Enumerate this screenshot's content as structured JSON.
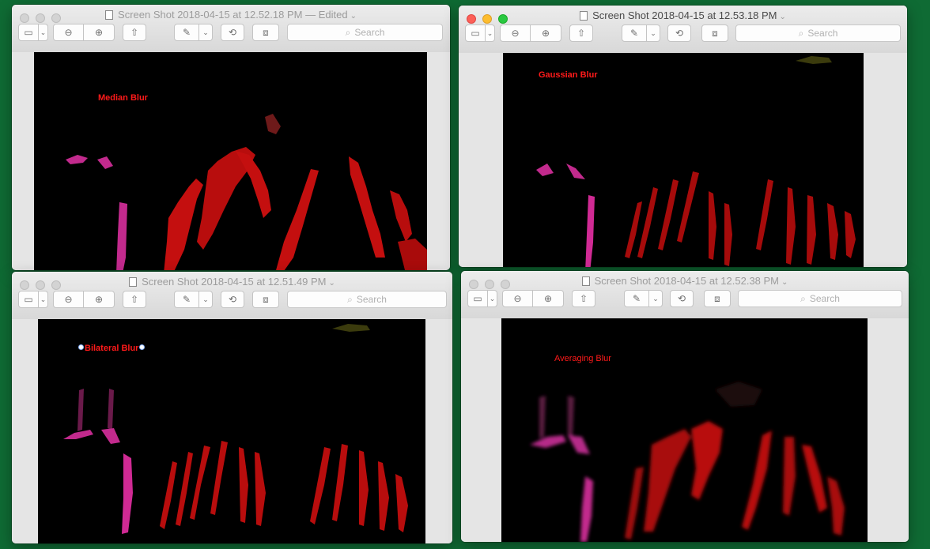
{
  "desktop_color": "#0f6b34",
  "toolbar_icons": {
    "sidebar": "sidebar-icon",
    "zoom_out": "zoom-out-icon",
    "zoom_in": "zoom-in-icon",
    "share": "share-icon",
    "markup": "markup-pen-icon",
    "rotate": "rotate-icon",
    "toolbox": "toolbox-icon",
    "search": "search-icon"
  },
  "windows": [
    {
      "title": "Screen Shot 2018-04-15 at 12.52.18 PM",
      "edited": "— Edited",
      "search_placeholder": "Search",
      "caption": "Median Blur",
      "active": false
    },
    {
      "title": "Screen Shot 2018-04-15 at 12.53.18 PM",
      "edited": "",
      "search_placeholder": "Search",
      "caption": "Gaussian Blur",
      "active": true
    },
    {
      "title": "Screen Shot 2018-04-15 at 12.51.49 PM",
      "edited": "",
      "search_placeholder": "Search",
      "caption": "Bilateral Blur",
      "active": false
    },
    {
      "title": "Screen Shot 2018-04-15 at 12.52.38 PM",
      "edited": "",
      "search_placeholder": "Search",
      "caption": "Averaging Blur",
      "active": false
    }
  ]
}
